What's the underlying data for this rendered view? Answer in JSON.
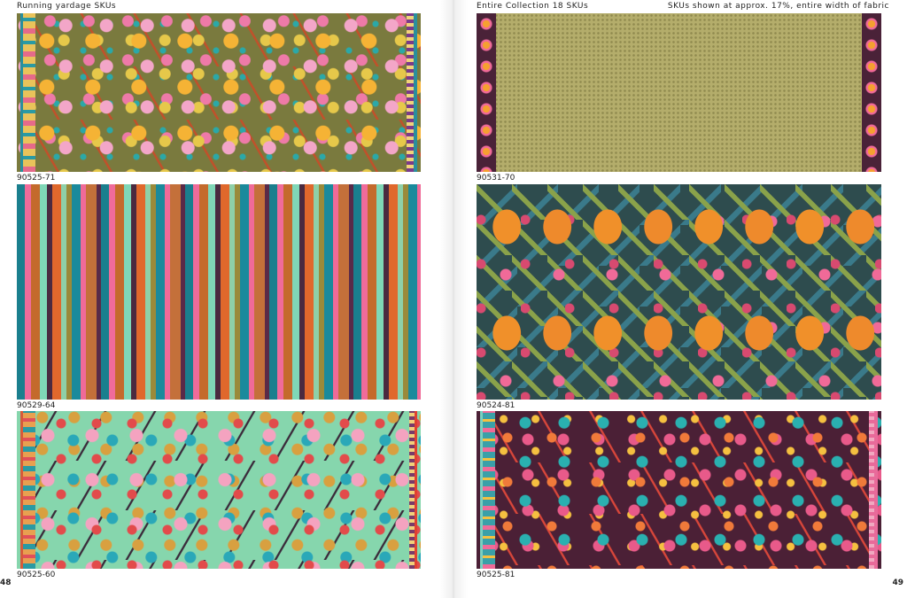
{
  "left_page": {
    "header": "Running yardage SKUs",
    "page_number": "48",
    "swatches": [
      {
        "sku": "90525-71",
        "pattern": "olive floral with pink and yellow blossoms, striped side borders"
      },
      {
        "sku": "90529-64",
        "pattern": "multicolor vertical stripes"
      },
      {
        "sku": "90525-60",
        "pattern": "mint floral with birds and branches, side borders"
      }
    ]
  },
  "right_page": {
    "header_left": "Entire Collection 18 SKUs",
    "header_right": "SKUs shown at approx. 17%, entire width of fabric",
    "page_number": "49",
    "swatches": [
      {
        "sku": "90531-70",
        "pattern": "khaki dot with plum floral borders"
      },
      {
        "sku": "90524-81",
        "pattern": "tigers in jungle foliage"
      },
      {
        "sku": "90525-81",
        "pattern": "plum floral with birds, side borders"
      }
    ]
  },
  "colors": {
    "olive": "#7a7a3e",
    "mint": "#86d6ad",
    "khaki": "#b4ad6b",
    "plum": "#4b2036",
    "teal": "#2e4c4e"
  }
}
